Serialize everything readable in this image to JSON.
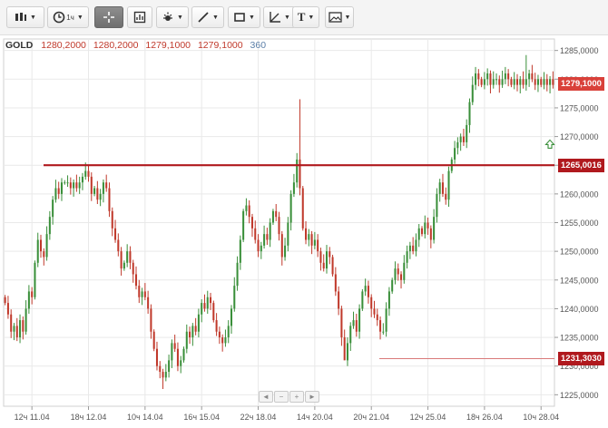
{
  "toolbar": {
    "buttons": [
      {
        "name": "chart-type-button",
        "icon": "candles-icon",
        "label": ""
      },
      {
        "name": "timeframe-button",
        "icon": "clock-icon",
        "label": "1ч"
      },
      {
        "name": "crosshair-button",
        "icon": "crosshair-icon",
        "label": ""
      },
      {
        "name": "indicators-button",
        "icon": "indicator-icon",
        "label": ""
      },
      {
        "name": "studies-button",
        "icon": "sun-icon",
        "label": ""
      },
      {
        "name": "line-tool-button",
        "icon": "line-icon",
        "label": ""
      },
      {
        "name": "shape-tool-button",
        "icon": "rectangle-icon",
        "label": ""
      },
      {
        "name": "fib-tool-button",
        "icon": "angle-icon",
        "label": ""
      },
      {
        "name": "text-tool-button",
        "icon": "text-icon",
        "label": "T"
      },
      {
        "name": "image-button",
        "icon": "image-icon",
        "label": ""
      }
    ]
  },
  "legend": {
    "symbol": "GOLD",
    "open": "1280,2000",
    "high": "1280,2000",
    "low": "1279,1000",
    "close": "1279,1000",
    "volume": "360"
  },
  "price_tags": {
    "current": "1279,1000",
    "resistance": "1265,0016",
    "support": "1231,3030"
  },
  "colors": {
    "up": "#3a8f3a",
    "down": "#c0392b",
    "hline": "#b0191e",
    "grid": "#e9e9e9",
    "current_tag": "#d9413a",
    "line_tag": "#b0191e"
  },
  "navigation": {
    "left": "◄",
    "minus": "−",
    "plus": "+",
    "right": "►"
  },
  "chart_data": {
    "type": "candlestick",
    "y_ticks": [
      "1285,0000",
      "1280,0000",
      "1275,0000",
      "1270,0000",
      "1265,0000",
      "1260,0000",
      "1255,0000",
      "1250,0000",
      "1245,0000",
      "1240,0000",
      "1235,0000",
      "1230,0000",
      "1225,0000"
    ],
    "y_tick_values": [
      1285,
      1280,
      1275,
      1270,
      1265,
      1260,
      1255,
      1250,
      1245,
      1240,
      1235,
      1230,
      1225
    ],
    "ylim": [
      1223,
      1287
    ],
    "x_ticks": [
      "12ч 11.04",
      "18ч 12.04",
      "10ч 14.04",
      "16ч 15.04",
      "22ч 18.04",
      "14ч 20.04",
      "20ч 21.04",
      "12ч 25.04",
      "18ч 26.04",
      "10ч 28.04"
    ],
    "x_tick_index": [
      9,
      28,
      47,
      66,
      85,
      104,
      123,
      142,
      161,
      180
    ],
    "horizontal_lines": [
      {
        "price": 1265.0016,
        "label": "1265,0016"
      },
      {
        "price": 1231.303,
        "label": "1231,3030"
      }
    ],
    "closes": [
      1241,
      1239,
      1236,
      1237,
      1235,
      1238,
      1236,
      1240,
      1243,
      1242,
      1248,
      1252,
      1250,
      1249,
      1253,
      1256,
      1259,
      1261,
      1260,
      1262,
      1262,
      1262,
      1261,
      1262,
      1261,
      1262,
      1263,
      1264,
      1263,
      1260,
      1261,
      1259,
      1260,
      1262,
      1261,
      1257,
      1254,
      1252,
      1250,
      1247,
      1248,
      1250,
      1248,
      1246,
      1244,
      1242,
      1243,
      1242,
      1240,
      1236,
      1233,
      1230,
      1229,
      1228,
      1229,
      1231,
      1234,
      1233,
      1230,
      1231,
      1233,
      1236,
      1235,
      1237,
      1236,
      1239,
      1241,
      1240,
      1242,
      1241,
      1238,
      1236,
      1235,
      1234,
      1235,
      1237,
      1240,
      1244,
      1248,
      1252,
      1257,
      1258,
      1256,
      1254,
      1252,
      1250,
      1251,
      1253,
      1252,
      1255,
      1257,
      1256,
      1253,
      1249,
      1251,
      1255,
      1260,
      1262,
      1266,
      1261,
      1254,
      1252,
      1253,
      1251,
      1252,
      1250,
      1248,
      1247,
      1250,
      1249,
      1246,
      1243,
      1240,
      1235,
      1231,
      1234,
      1237,
      1238,
      1236,
      1240,
      1243,
      1244,
      1242,
      1240,
      1239,
      1238,
      1236,
      1236,
      1240,
      1243,
      1245,
      1247,
      1246,
      1245,
      1248,
      1250,
      1251,
      1250,
      1252,
      1254,
      1253,
      1255,
      1254,
      1252,
      1256,
      1260,
      1262,
      1260,
      1259,
      1264,
      1266,
      1268,
      1269,
      1270,
      1269,
      1272,
      1276,
      1279,
      1281,
      1280,
      1279,
      1280,
      1281,
      1279,
      1280,
      1280,
      1279,
      1280,
      1281,
      1280,
      1279,
      1280,
      1279,
      1280,
      1279,
      1280,
      1281,
      1280,
      1279,
      1280,
      1279,
      1280,
      1279,
      1280,
      1279
    ]
  }
}
